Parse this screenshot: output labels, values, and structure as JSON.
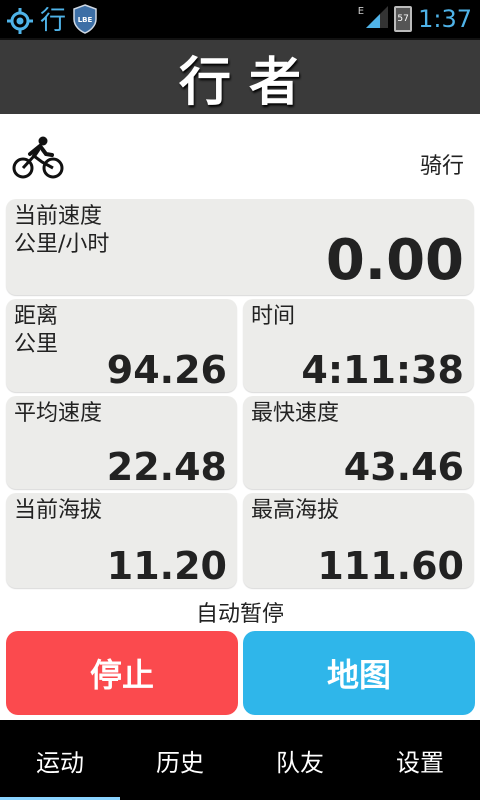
{
  "status_bar": {
    "app_glyph": "行",
    "network": "E",
    "battery": "57",
    "time": "1:37",
    "accent": "#4fb3e8"
  },
  "header": {
    "title": "行者"
  },
  "mode": {
    "label": "骑行",
    "icon": "bicycle-icon"
  },
  "stats": {
    "current_speed": {
      "label": "当前速度",
      "unit": "公里/小时",
      "value": "0.00"
    },
    "distance": {
      "label": "距离",
      "unit": "公里",
      "value": "94.26"
    },
    "time": {
      "label": "时间",
      "value": "4:11:38"
    },
    "avg_speed": {
      "label": "平均速度",
      "value": "22.48"
    },
    "max_speed": {
      "label": "最快速度",
      "value": "43.46"
    },
    "current_altitude": {
      "label": "当前海拔",
      "value": "11.20"
    },
    "max_altitude": {
      "label": "最高海拔",
      "value": "111.60"
    }
  },
  "auto_pause": "自动暂停",
  "actions": {
    "stop": {
      "label": "停止",
      "color": "#fb4a4e"
    },
    "map": {
      "label": "地图",
      "color": "#2fb6ea"
    }
  },
  "nav": {
    "items": [
      {
        "label": "运动",
        "active": true
      },
      {
        "label": "历史"
      },
      {
        "label": "队友"
      },
      {
        "label": "设置"
      }
    ]
  }
}
